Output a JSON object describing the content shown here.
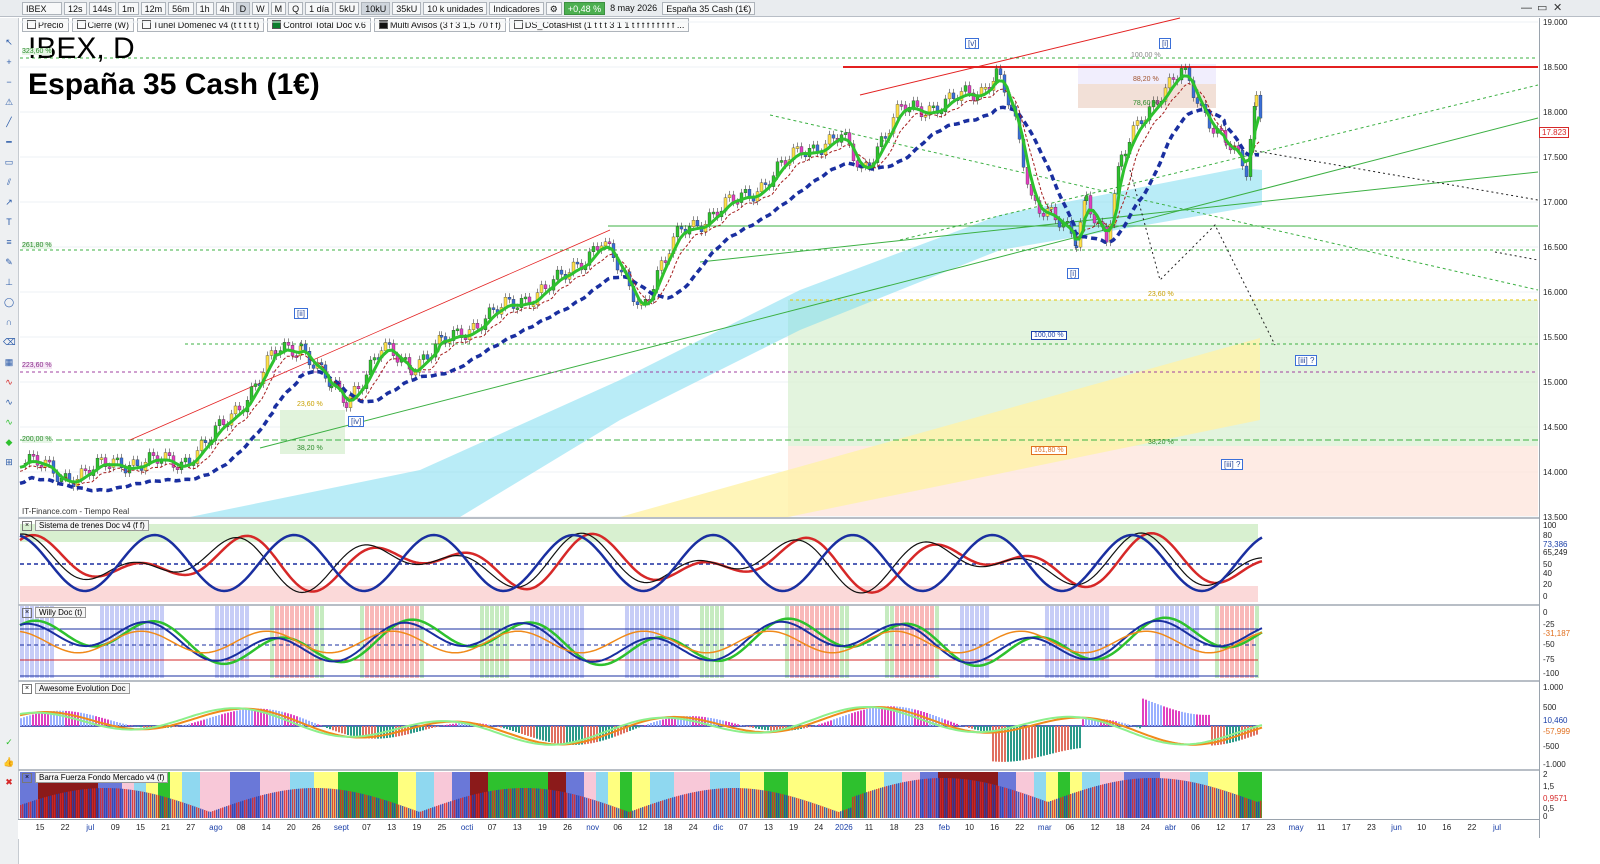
{
  "toolbar": {
    "symbol": "IBEX",
    "intervals": [
      "12s",
      "144s",
      "1m",
      "12m",
      "56m",
      "1h",
      "4h",
      "D",
      "W",
      "M",
      "Q"
    ],
    "selected_interval": "D",
    "period": "1 día",
    "volume_options": [
      "5kU",
      "10kU",
      "35kU"
    ],
    "selected_volume": "10kU",
    "units": "10 k unidades",
    "indicators_label": "Indicadores",
    "change_badge": "+0,48 %",
    "date": "8 may 2026",
    "instrument": "España 35 Cash (1€)"
  },
  "indicator_chips": [
    "Precio",
    "Cierre (W)",
    "Tunel Domenec v4 (t t t t t)",
    "Control Total Doc v.6",
    "Multi Avisos (3 f 3 1,5 70 f f)",
    "DS_CotasHist (1 t t t 3 1 1 t f f f f f f f f ..."
  ],
  "chart": {
    "title_line1": "IBEX, D",
    "title_line2": "España 35 Cash (1€)",
    "credit": "IT-Finance.com - Tiempo Real",
    "price_axis": [
      "19.000",
      "18.500",
      "18.000",
      "17.500",
      "17.000",
      "16.500",
      "16.000",
      "15.500",
      "15.000",
      "14.500",
      "14.000",
      "13.500"
    ],
    "price_tags": [
      {
        "text": "17.823",
        "color": "#d62828"
      },
      {
        "text": "17.??",
        "color": "#1a3fa8"
      }
    ],
    "wave_labels": [
      "[v]",
      "[i]",
      "[ii]",
      "[iv]",
      "[i]",
      "[iii] ?",
      "[iii] ?"
    ],
    "fib_labels_left": [
      "323,60 %",
      "261,80 %",
      "223,60 %",
      "200,00 %"
    ],
    "fib_labels_main": [
      "100,00 %",
      "88,20 %",
      "78,60 %",
      "23,60 %",
      "100,00 %",
      "38,20 %",
      "161,80 %",
      "23,60 %",
      "38,20 %"
    ]
  },
  "panels": [
    {
      "name": "Sistema de trenes Doc v4 (f f)",
      "axis": [
        "100",
        "80",
        "73,386",
        "65,249",
        "50",
        "40",
        "20",
        "0"
      ]
    },
    {
      "name": "Willy Doc (t)",
      "axis": [
        "0",
        "-25",
        "-31,187",
        "-50",
        "-75",
        "-100"
      ]
    },
    {
      "name": "Awesome Evolution Doc",
      "axis": [
        "1.000",
        "500",
        "10,460",
        "-57,999",
        "-500",
        "-1.000"
      ]
    },
    {
      "name": "Barra Fuerza Fondo Mercado v4 (f)",
      "axis": [
        "2",
        "1,5",
        "0,9571",
        "0,5",
        "0"
      ]
    }
  ],
  "x_axis": [
    "15",
    "22",
    "jul",
    "09",
    "15",
    "21",
    "27",
    "ago",
    "08",
    "14",
    "20",
    "26",
    "sept",
    "07",
    "13",
    "19",
    "25",
    "octi",
    "07",
    "13",
    "19",
    "26",
    "nov",
    "06",
    "12",
    "18",
    "24",
    "dic",
    "07",
    "13",
    "19",
    "24",
    "2026",
    "11",
    "18",
    "23",
    "feb",
    "10",
    "16",
    "22",
    "mar",
    "06",
    "12",
    "18",
    "24",
    "abr",
    "06",
    "12",
    "17",
    "23",
    "may",
    "11",
    "17",
    "23",
    "jun",
    "10",
    "16",
    "22",
    "jul"
  ],
  "colors": {
    "bull": "#2ec12e",
    "bear": "#d62828",
    "trend_blue": "#1a2fa0",
    "cyan_band": "#7fdcf0",
    "resistance": "#e32020"
  }
}
